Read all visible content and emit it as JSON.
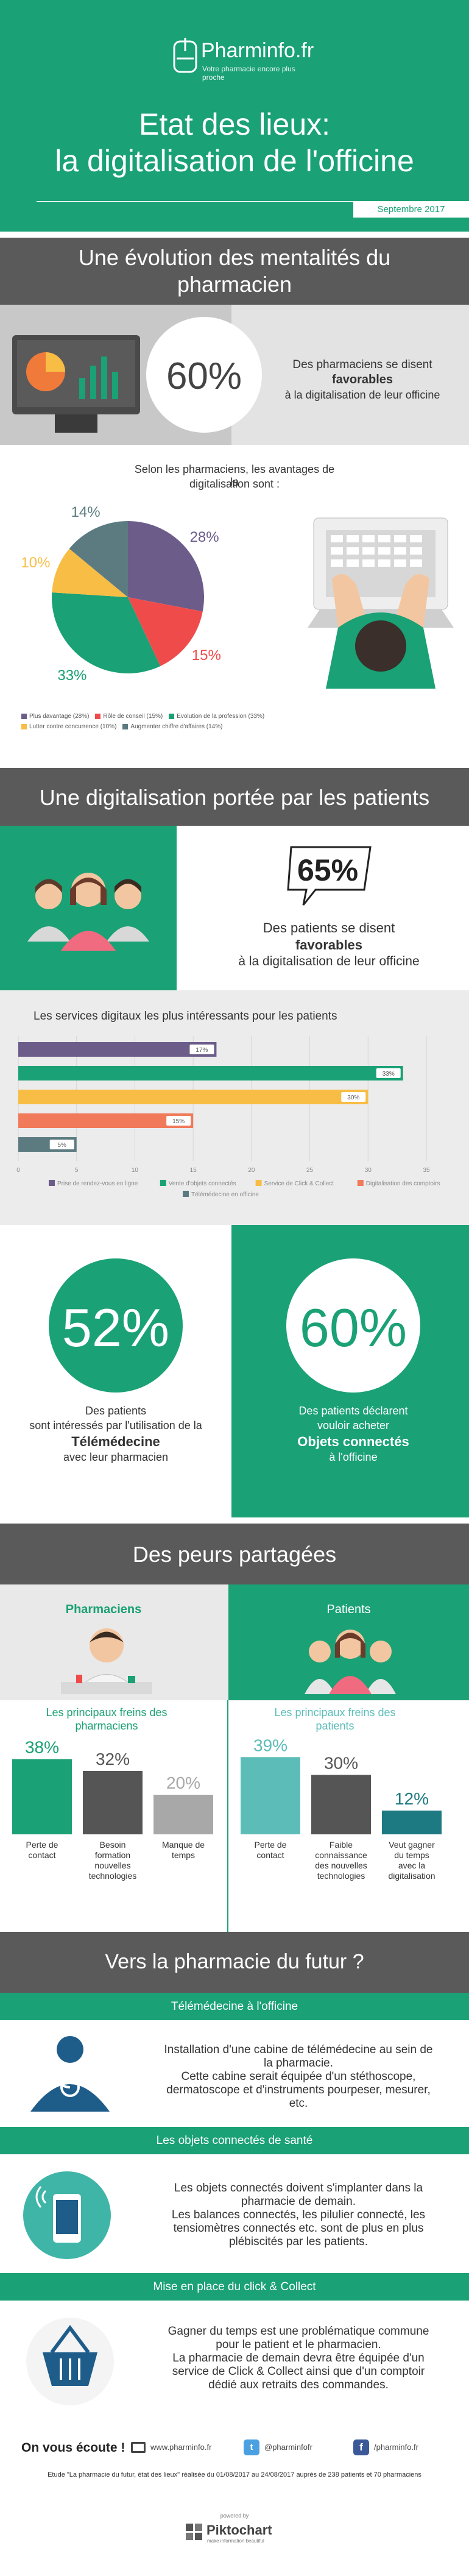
{
  "header": {
    "brand": "Pharminfo.fr",
    "tagline": "Votre pharmacie encore plus proche",
    "title_line1": "Etat des lieux:",
    "title_line2": "la digitalisation de l'officine",
    "date": "Septembre 2017"
  },
  "section1": {
    "title_line1": "Une évolution des mentalités du",
    "title_line2": "pharmacien",
    "stat": "60%",
    "stat_text1": "Des pharmaciens se disent",
    "stat_text_bold": "favorables",
    "stat_text2": "à la digitalisation de leur officine",
    "pie_intro1": "Selon les pharmaciens, les avantages de la",
    "pie_intro2": "digitalisation sont :"
  },
  "section2": {
    "title": "Une digitalisation portée par les patients",
    "stat": "65%",
    "stat_text1": "Des patients se disent",
    "stat_text_bold": "favorables",
    "stat_text2": "à la digitalisation de leur officine",
    "bar_title": "Les services digitaux les plus intéressants pour les patients"
  },
  "section3": {
    "left_stat": "52%",
    "left_text1": "Des patients",
    "left_text2": "sont intéressés par l'utilisation de la",
    "left_bold": "Télémédecine",
    "left_text3": "avec leur pharmacien",
    "right_stat": "60%",
    "right_text1": "Des patients déclarent",
    "right_text2": "vouloir acheter",
    "right_bold": "Objets connectés",
    "right_text3": "à l'officine"
  },
  "section4": {
    "title": "Des peurs partagées",
    "pharma_label": "Pharmaciens",
    "patients_label": "Patients",
    "pharma_sub1": "Les principaux freins des",
    "pharma_sub2": "pharmaciens",
    "patients_sub1": "Les principaux freins des",
    "patients_sub2": "patients"
  },
  "section5": {
    "title": "Vers la pharmacie du futur ?",
    "tele_title": "Télémédecine à l'officine",
    "tele_p1": "Installation d'une cabine de télémédecine au sein de",
    "tele_p2": "la pharmacie.",
    "tele_p3": "Cette cabine serait équipée d'un stéthoscope,",
    "tele_p4": "dermatoscope et d'instruments pourpeser, mesurer,",
    "tele_p5": "etc.",
    "obj_title": "Les objets connectés de santé",
    "obj_p1": "Les objets connectés doivent s'implanter dans la",
    "obj_p2": "pharmacie de demain.",
    "obj_p3": "Les balances connectés, les pilulier connecté, les",
    "obj_p4": "tensiomètres connectés etc. sont de plus en plus",
    "obj_p5": "plébiscités par les patients.",
    "click_title": "Mise en place du click & Collect",
    "click_p1": "Gagner du temps est une problématique commune",
    "click_p2": "pour le patient et le pharmacien.",
    "click_p3": "La pharmacie de demain devra être équipée d'un",
    "click_p4": "service de Click & Collect ainsi que d'un comptoir",
    "click_p5": "dédié aux retraits des commandes."
  },
  "footer": {
    "listen": "On vous écoute !",
    "web": "www.pharminfo.fr",
    "twitter": "@pharminfofr",
    "facebook": "/pharminfo.fr",
    "study": "Etude \"La pharmacie du futur, état des lieux\" réalisée du 01/08/2017 au 24/08/2017 auprès de 238 patients et 70 pharmaciens",
    "powered": "powered by",
    "piktochart": "Piktochart",
    "pikto_tag": "make information beautiful"
  },
  "colors": {
    "green": "#1aa175",
    "dark": "#5a5a5a",
    "purple": "#6b5c8a",
    "red": "#f04b4b",
    "yellow": "#f8bd45",
    "slate": "#5b7b80",
    "teal_light": "#5cbdb8",
    "teal_dark": "#1e7a82"
  },
  "chart_data": [
    {
      "type": "pie",
      "labels": [
        "Plus davantage (28%)",
        "Rôle de conseil (15%)",
        "Evolution de la profession (33%)",
        "Lutter contre concurrence (10%)",
        "Augmenter chiffre d'affaires (14%)"
      ],
      "values": [
        28,
        15,
        33,
        10,
        14
      ],
      "data_labels": [
        "28%",
        "15%",
        "33%",
        "10%",
        "14%"
      ],
      "colors": [
        "#6b5c8a",
        "#f04b4b",
        "#1aa175",
        "#f8bd45",
        "#5b7b80"
      ],
      "legend": "bottom"
    },
    {
      "type": "bar",
      "orientation": "horizontal",
      "categories": [
        "Prise de rendez-vous en ligne",
        "Vente d'objets connectés",
        "Service de Click & Collect",
        "Digitalisation des comptoirs",
        "Télémédecine en officine"
      ],
      "values": [
        17,
        33,
        30,
        15,
        5
      ],
      "data_labels": [
        "17%",
        "33%",
        "30%",
        "15%",
        "5%"
      ],
      "colors": [
        "#6b5c8a",
        "#1aa175",
        "#f8bd45",
        "#f07a5a",
        "#5b7b80"
      ],
      "xlim": [
        0,
        35
      ],
      "xticks": [
        "0",
        "5",
        "10",
        "15",
        "20",
        "25",
        "30",
        "35"
      ],
      "legend": "bottom"
    },
    {
      "type": "bar",
      "title": "Pharmaciens",
      "categories": [
        "Perte de contact",
        "Besoin formation nouvelles technologies",
        "Manque de temps"
      ],
      "category_lines": [
        [
          "Perte de",
          "contact"
        ],
        [
          "Besoin",
          "formation",
          "nouvelles",
          "technologies"
        ],
        [
          "Manque de",
          "temps"
        ]
      ],
      "values": [
        38,
        32,
        20
      ],
      "data_labels": [
        "38%",
        "32%",
        "20%"
      ],
      "colors": [
        "#1aa175",
        "#555555",
        "#a8a8a8"
      ]
    },
    {
      "type": "bar",
      "title": "Patients",
      "categories": [
        "Perte de contact",
        "Faible connaissance des nouvelles technologies",
        "Veut gagner du temps avec la digitalisation"
      ],
      "category_lines": [
        [
          "Perte de",
          "contact"
        ],
        [
          "Faible",
          "connaissance",
          "des nouvelles",
          "technologies"
        ],
        [
          "Veut gagner",
          "du temps",
          "avec la",
          "digitalisation"
        ]
      ],
      "values": [
        39,
        30,
        12
      ],
      "data_labels": [
        "39%",
        "30%",
        "12%"
      ],
      "colors": [
        "#5cbdb8",
        "#555555",
        "#1e7a82"
      ]
    }
  ]
}
